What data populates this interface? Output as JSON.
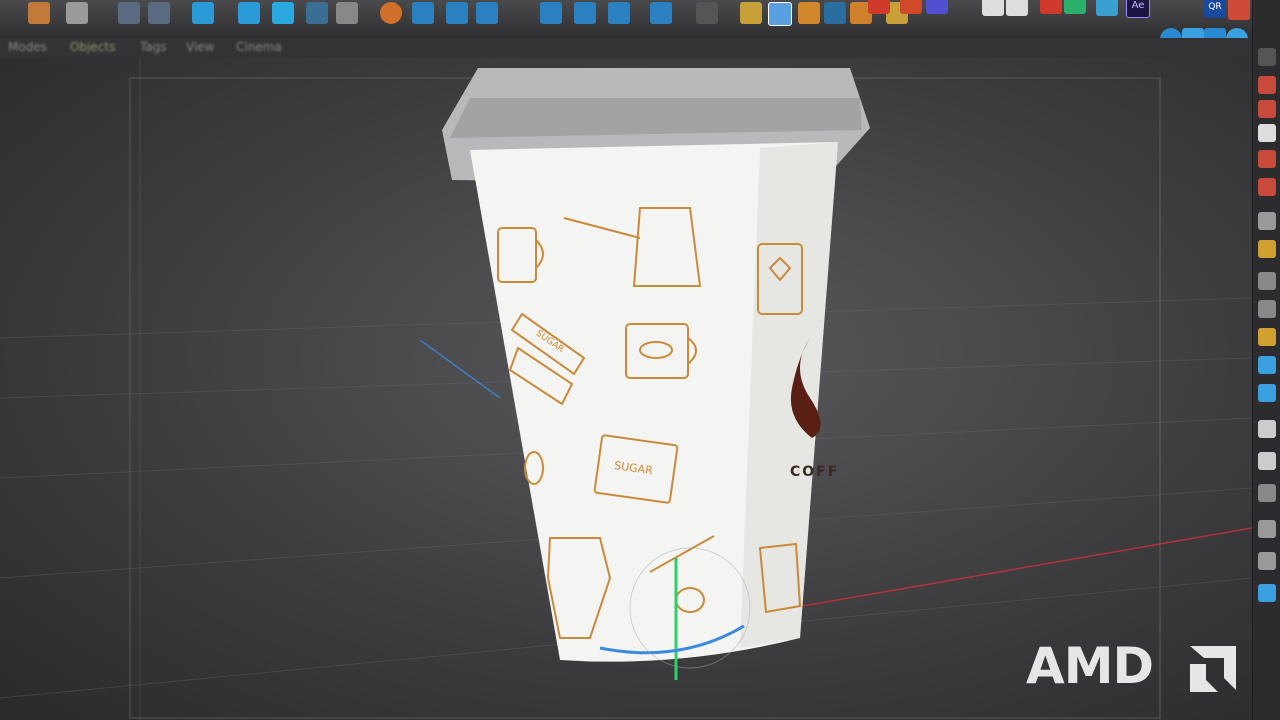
{
  "toolbar": {
    "icons": [
      "object-icon",
      "render-icon",
      "move-icon",
      "scale-icon",
      "rotate-icon",
      "cube-icon",
      "spline-icon",
      "nurbs-icon",
      "deformer-icon",
      "light-icon",
      "camera-icon",
      "tag-icon",
      "snap-icon",
      "plugin-icon",
      "ae-icon"
    ],
    "ae_label": "Ae",
    "qr_label": "QR"
  },
  "menubar": {
    "items": [
      "Modes",
      "Objects",
      "Tags",
      "View",
      "Cinema"
    ]
  },
  "viewport": {
    "cup_labels": {
      "sugar_1": "SUGAR",
      "sugar_2": "SUGAR",
      "brand_partial": "COFF"
    }
  },
  "brand": {
    "logo_text": "AMD",
    "color": "#e6e6e6"
  },
  "colors": {
    "cup_print": "#c98a3a",
    "axis_x": "#d0303a",
    "axis_y": "#2fcf6a",
    "axis_z": "#3a8adf"
  }
}
